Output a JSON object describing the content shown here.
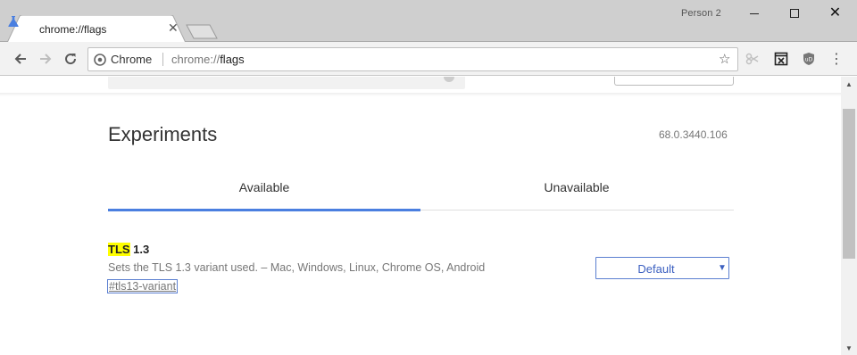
{
  "window": {
    "profile": "Person 2",
    "minimize_icon": "minimize-icon",
    "maximize_icon": "maximize-icon",
    "close_icon": "close-icon"
  },
  "tab": {
    "title": "chrome://flags",
    "icon": "flask-icon"
  },
  "toolbar": {
    "omnibox_chip": "Chrome",
    "url_scheme": "chrome://",
    "url_host": "flags"
  },
  "page": {
    "title": "Experiments",
    "version": "68.0.3440.106",
    "tabs": [
      {
        "label": "Available",
        "active": true
      },
      {
        "label": "Unavailable",
        "active": false
      }
    ]
  },
  "flag": {
    "name_highlight": "TLS",
    "name_rest": " 1.3",
    "description": "Sets the TLS 1.3 variant used. – Mac, Windows, Linux, Chrome OS, Android",
    "link": "#tls13-variant",
    "select_value": "Default"
  },
  "colors": {
    "accent": "#4a7fe0",
    "highlight": "#ffff00",
    "select_border": "#5b7fd0"
  }
}
